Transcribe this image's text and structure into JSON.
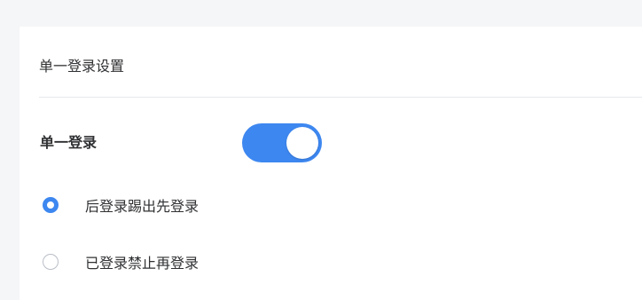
{
  "panel": {
    "title": "单一登录设置"
  },
  "single_login": {
    "label": "单一登录",
    "enabled": true
  },
  "options": [
    {
      "label": "后登录踢出先登录",
      "selected": true
    },
    {
      "label": "已登录禁止再登录",
      "selected": false
    }
  ],
  "colors": {
    "accent": "#3d87f0",
    "background": "#f5f6f8"
  }
}
